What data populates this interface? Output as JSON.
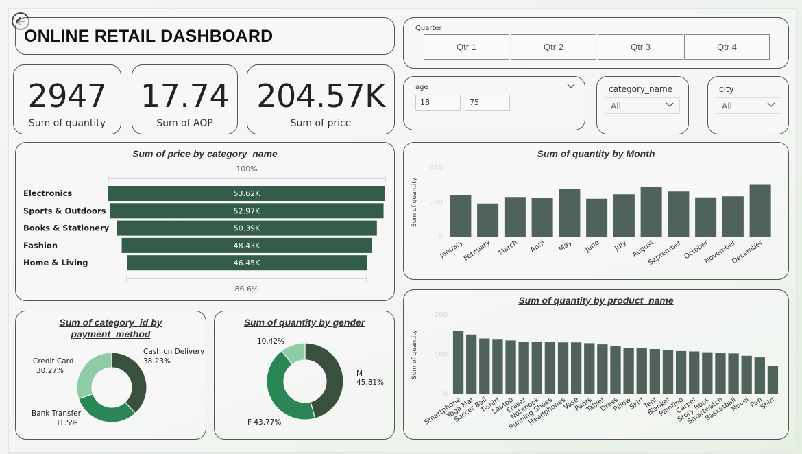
{
  "header": {
    "title": "ONLINE RETAIL DASHBOARD",
    "back_icon": "back-arrow-icon"
  },
  "kpis": [
    {
      "value": "2947",
      "label": "Sum of quantity"
    },
    {
      "value": "17.74",
      "label": "Sum of AOP"
    },
    {
      "value": "204.57K",
      "label": "Sum of price"
    }
  ],
  "quarter_slicer": {
    "title": "Quarter",
    "options": [
      "Qtr 1",
      "Qtr 2",
      "Qtr 3",
      "Qtr 4"
    ]
  },
  "age_slicer": {
    "title": "age",
    "min": "18",
    "max": "75"
  },
  "category_slicer": {
    "title": "category_name",
    "value": "All"
  },
  "city_slicer": {
    "title": "city",
    "value": "All"
  },
  "colors": {
    "bar": "#4f635b",
    "funnel": "#335c49",
    "dark": "#39503f",
    "mid": "#2b8655",
    "light": "#8fcba5"
  },
  "charts": {
    "funnel": {
      "title": "Sum of price by category_name",
      "top_label": "100%",
      "bottom_label": "86.6%"
    },
    "month": {
      "title": "Sum of quantity by Month",
      "ylabel": "Sum of quantity"
    },
    "payment": {
      "title_line1": "Sum of category_id by",
      "title_line2": "payment_method"
    },
    "gender": {
      "title": "Sum of quantity by gender"
    },
    "product": {
      "title": "Sum of quantity by product_name",
      "ylabel": "Sum of quantity"
    }
  },
  "chart_data": [
    {
      "type": "bar",
      "orientation": "funnel",
      "title": "Sum of price by category_name",
      "categories": [
        "Electronics",
        "Sports & Outdoors",
        "Books & Stationery",
        "Fashion",
        "Home & Living"
      ],
      "values": [
        53.62,
        52.97,
        50.39,
        48.43,
        46.45
      ],
      "labels": [
        "53.62K",
        "52.97K",
        "50.39K",
        "48.43K",
        "46.45K"
      ]
    },
    {
      "type": "bar",
      "title": "Sum of quantity by Month",
      "ylabel": "Sum of quantity",
      "categories": [
        "January",
        "February",
        "March",
        "April",
        "May",
        "June",
        "July",
        "August",
        "September",
        "October",
        "November",
        "December"
      ],
      "values": [
        243,
        193,
        231,
        225,
        276,
        221,
        247,
        288,
        263,
        229,
        235,
        302
      ],
      "ylim": [
        0,
        400
      ],
      "yticks": [
        0,
        200,
        400
      ]
    },
    {
      "type": "pie",
      "title": "Sum of category_id by payment_method",
      "categories": [
        "Cash on Delivery",
        "Bank Transfer",
        "Credit Card"
      ],
      "values": [
        38.23,
        31.5,
        30.27
      ],
      "labels": [
        "38.23%",
        "31.5%",
        "30.27%"
      ]
    },
    {
      "type": "pie",
      "title": "Sum of quantity by gender",
      "categories": [
        "M",
        "F",
        ""
      ],
      "values": [
        45.81,
        43.77,
        10.42
      ],
      "labels": [
        "45.81%",
        "43.77%",
        "10.42%"
      ]
    },
    {
      "type": "bar",
      "title": "Sum of quantity by product_name",
      "ylabel": "Sum of quantity",
      "categories": [
        "Smartphone",
        "Yoga Mat",
        "Soccer Ball",
        "T-shirt",
        "Laptop",
        "Eraser",
        "Notebook",
        "Running Shoes",
        "Headphones",
        "Vase",
        "Pants",
        "Tablet",
        "Dress",
        "Pillow",
        "Skirt",
        "Tent",
        "Blanket",
        "Painting",
        "Carpet",
        "Story Book",
        "Smartwatch",
        "Basketball",
        "Novel",
        "Pen",
        "Shirt"
      ],
      "values": [
        160,
        150,
        140,
        137,
        135,
        132,
        132,
        132,
        130,
        130,
        128,
        125,
        121,
        116,
        115,
        113,
        110,
        108,
        107,
        105,
        104,
        102,
        96,
        92,
        70
      ],
      "ylim": [
        0,
        200
      ],
      "yticks": [
        0,
        100,
        200
      ]
    }
  ]
}
